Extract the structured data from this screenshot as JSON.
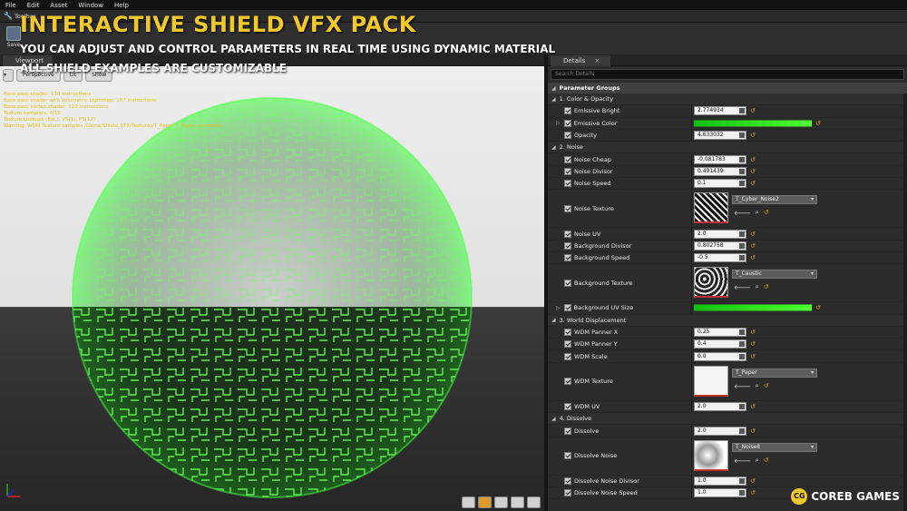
{
  "menu": [
    "File",
    "Edit",
    "Asset",
    "Window",
    "Help"
  ],
  "toolbar": {
    "tab_label": "Toolbar",
    "save_label": "Save"
  },
  "overlay": {
    "title": "INTERACTIVE SHIELD VFX PACK",
    "line1": "YOU CAN ADJUST AND CONTROL PARAMETERS IN REAL TIME USING DYNAMIC MATERIAL",
    "line2": "ALL SHIELD EXAMPLES ARE CUSTOMIZABLE"
  },
  "viewport": {
    "tab": "Viewport",
    "perspective": "Perspective",
    "lit": "Lit",
    "show": "Show",
    "stats": [
      "Base pass shader: 130 instructions",
      "Base pass shader with Volumetric Lightmap: 157 instructions",
      "Base pass vertex shader: 110 instructions",
      "Texture samplers: 4/16",
      "Texture Lookups (Est.): VS(1), PS(12)",
      "Warning: WDM Texture samples /Game/Shield_VFX/Textures/T_Paper T_Paper as normal"
    ]
  },
  "details": {
    "tab": "Details",
    "search_placeholder": "Search Details",
    "header": "Parameter Groups",
    "rows": [
      {
        "kind": "group",
        "label": "1. Color & Opacity"
      },
      {
        "kind": "num",
        "label": "Emissive Bright",
        "value": "2.774934"
      },
      {
        "kind": "color",
        "label": "Emissive Color",
        "expand": true
      },
      {
        "kind": "num",
        "label": "Opacity",
        "value": "4.633032"
      },
      {
        "kind": "group",
        "label": "2. Noise"
      },
      {
        "kind": "num",
        "label": "Noise Cheap",
        "value": "-0.081783"
      },
      {
        "kind": "num",
        "label": "Noise Divisor",
        "value": "0.491439"
      },
      {
        "kind": "num",
        "label": "Noise Speed",
        "value": "0.1"
      },
      {
        "kind": "tex",
        "label": "Noise Texture",
        "asset": "T_Cyber_Noise2"
      },
      {
        "kind": "num",
        "label": "Noise UV",
        "value": "2.0"
      },
      {
        "kind": "num",
        "label": "Background Divisor",
        "value": "0.802758"
      },
      {
        "kind": "num",
        "label": "Background Speed",
        "value": "-0.5"
      },
      {
        "kind": "tex",
        "label": "Background Texture",
        "asset": "T_Caustic"
      },
      {
        "kind": "color",
        "label": "Background UV Size",
        "expand": true
      },
      {
        "kind": "group",
        "label": "3. World Displacement"
      },
      {
        "kind": "num",
        "label": "WDM Panner X",
        "value": "0.25"
      },
      {
        "kind": "num",
        "label": "WDM Panner Y",
        "value": "0.4"
      },
      {
        "kind": "num",
        "label": "WDM Scale",
        "value": "0.0"
      },
      {
        "kind": "tex",
        "label": "WDM Texture",
        "asset": "T_Paper"
      },
      {
        "kind": "num",
        "label": "WDM UV",
        "value": "2.0"
      },
      {
        "kind": "group",
        "label": "4. Dissolve"
      },
      {
        "kind": "num",
        "label": "Dissolve",
        "value": "2.0"
      },
      {
        "kind": "tex",
        "label": "Dissolve Noise",
        "asset": "T_Noise8"
      },
      {
        "kind": "num",
        "label": "Dissolve Noise Divisor",
        "value": "1.0"
      },
      {
        "kind": "num",
        "label": "Dissolve Noise Speed",
        "value": "1.0"
      }
    ]
  },
  "logo": {
    "mark": "CG",
    "name": "COREB GAMES"
  },
  "colors": {
    "accent_yellow": "#f2c92c",
    "shield_green": "#39ff3a",
    "color_bar": "#22e020"
  }
}
